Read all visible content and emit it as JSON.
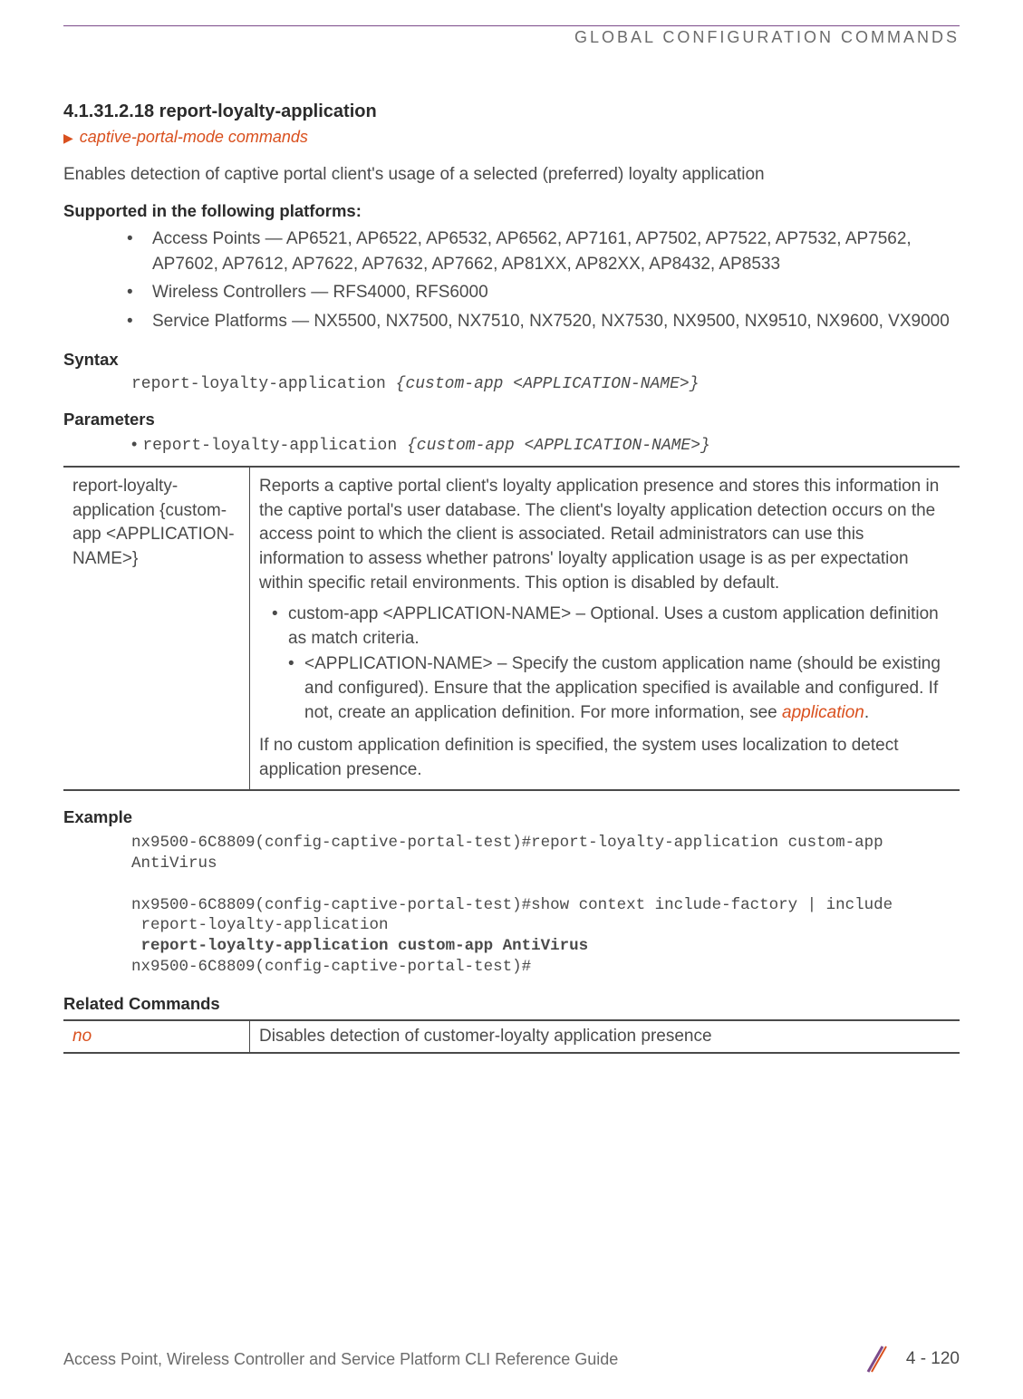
{
  "runningHead": "GLOBAL CONFIGURATION COMMANDS",
  "section": {
    "number": "4.1.31.2.18",
    "title": "report-loyalty-application"
  },
  "breadcrumb": "captive-portal-mode commands",
  "intro": "Enables detection of captive portal client's usage of a selected (preferred) loyalty application",
  "platformsHeading": "Supported in the following platforms:",
  "platforms": [
    "Access Points — AP6521, AP6522, AP6532, AP6562, AP7161, AP7502, AP7522, AP7532, AP7562, AP7602, AP7612, AP7622, AP7632, AP7662, AP81XX, AP82XX, AP8432, AP8533",
    "Wireless Controllers — RFS4000, RFS6000",
    "Service Platforms — NX5500, NX7500, NX7510, NX7520, NX7530, NX9500, NX9510, NX9600, VX9000"
  ],
  "syntaxHeading": "Syntax",
  "syntax": {
    "cmd": "report-loyalty-application ",
    "arg": "{custom-app <APPLICATION-NAME>}"
  },
  "parametersHeading": "Parameters",
  "paramLine": {
    "cmd": "report-loyalty-application ",
    "arg": "{custom-app <APPLICATION-NAME>}"
  },
  "paramTable": {
    "left": "report-loyalty-application {custom-app <APPLICATION-NAME>}",
    "desc": "Reports a captive portal client's loyalty application presence and stores this information in the captive portal's user database. The client's loyalty application detection occurs on the access point to which the client is associated. Retail administrators can use this information to assess whether patrons' loyalty application usage is as per expectation within specific retail environments. This option is disabled by default.",
    "sub1": "custom-app <APPLICATION-NAME> – Optional. Uses a custom application definition as match criteria.",
    "sub2a": "<APPLICATION-NAME> – Specify the custom application name (should be existing and configured). Ensure that the application specified is available and configured. If not, create an application definition. For more information, see ",
    "sub2link": "application",
    "sub2b": ".",
    "tail": "If no custom application definition is specified, the system uses localization to detect application presence."
  },
  "exampleHeading": "Example",
  "example": {
    "l1": "nx9500-6C8809(config-captive-portal-test)#report-loyalty-application custom-app AntiVirus",
    "l2": "nx9500-6C8809(config-captive-portal-test)#show context include-factory | include",
    "l3": " report-loyalty-application",
    "l4": " report-loyalty-application custom-app AntiVirus",
    "l5": "nx9500-6C8809(config-captive-portal-test)#"
  },
  "relatedHeading": "Related Commands",
  "related": {
    "cmd": "no",
    "desc": "Disables detection of customer-loyalty application presence"
  },
  "footer": {
    "left": "Access Point, Wireless Controller and Service Platform CLI Reference Guide",
    "page": "4 - 120"
  }
}
